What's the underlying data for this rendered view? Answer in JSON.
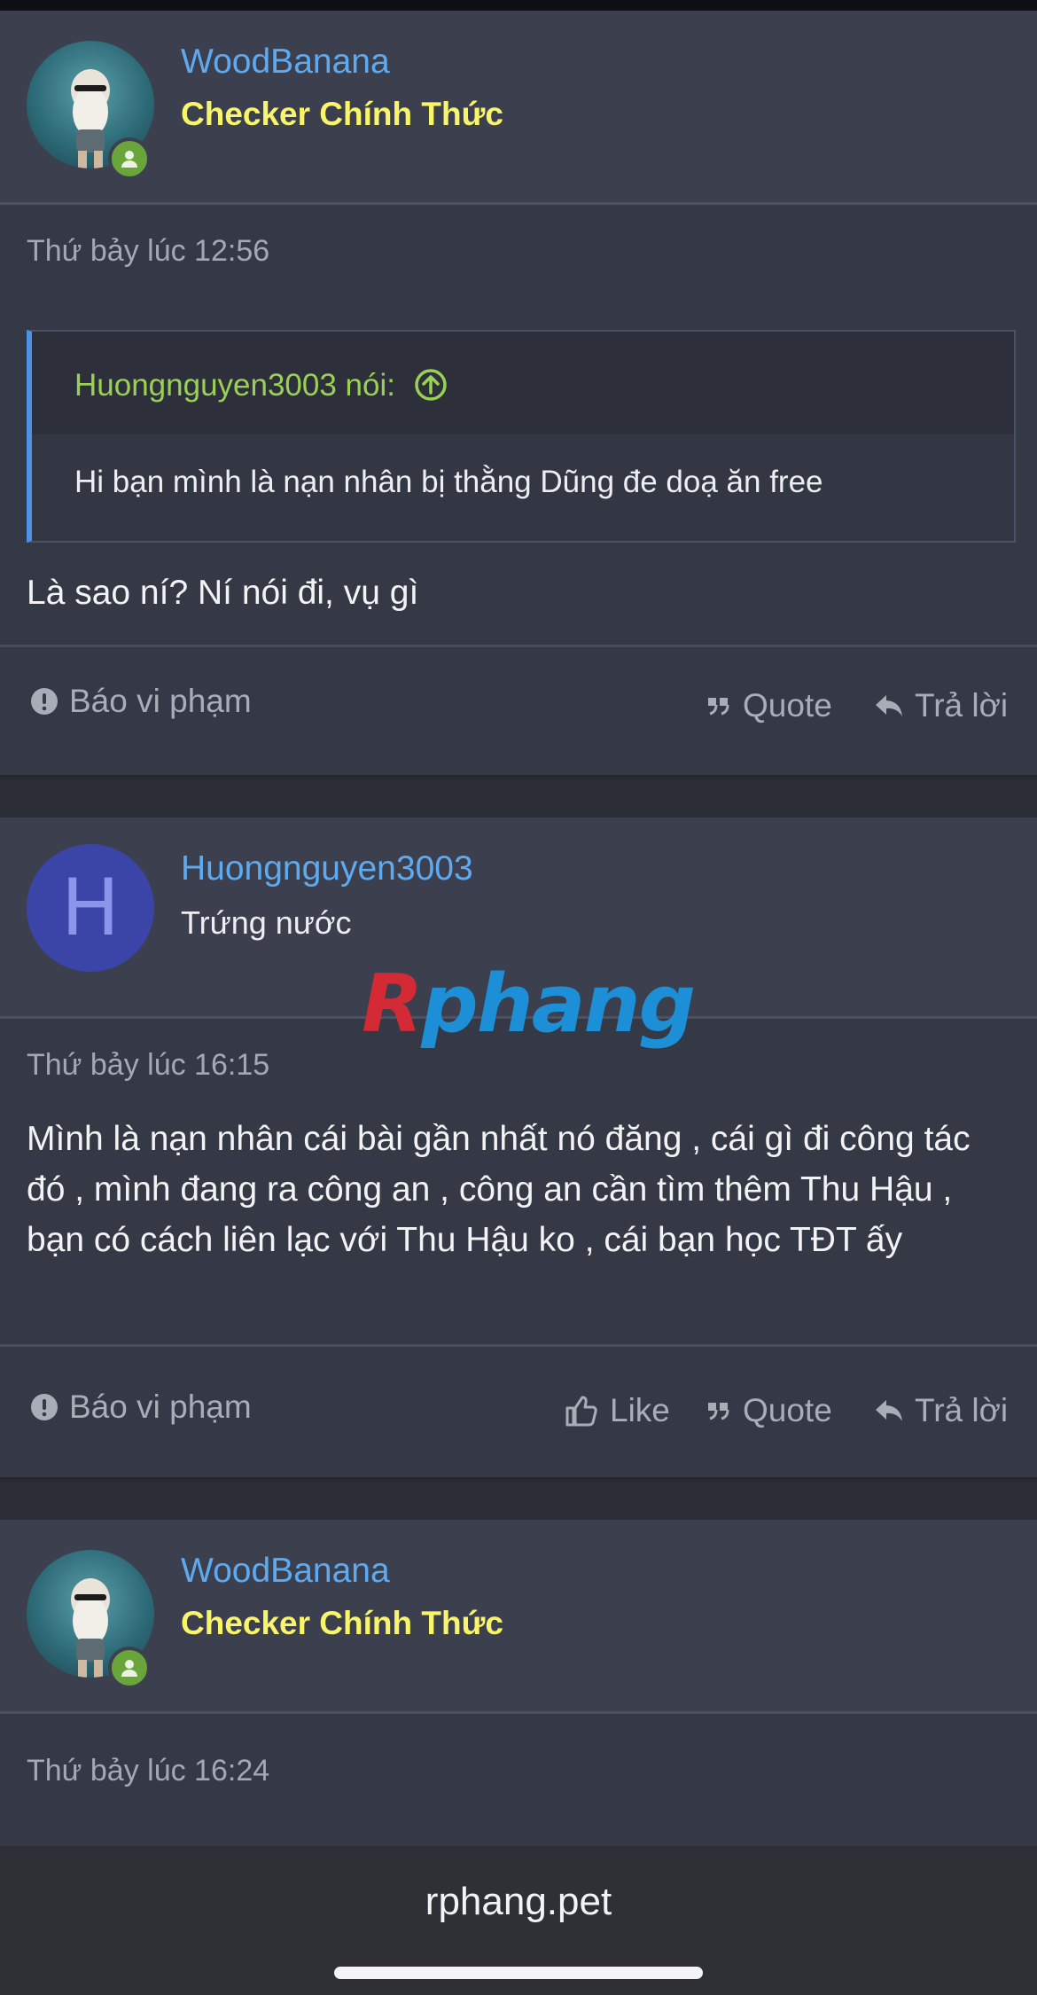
{
  "posts": [
    {
      "author": "WoodBanana",
      "user_title": "Checker Chính Thức",
      "timestamp": "Thứ bảy lúc 12:56",
      "quote_author": "Huongnguyen3003 nói:",
      "quote_text": "Hi bạn mình là nạn nhân bị thằng Dũng đe doạ ăn free",
      "message": "Là sao ní? Ní nói đi, vụ gì",
      "actions": {
        "report": "Báo vi phạm",
        "quote": "Quote",
        "reply": "Trả lời"
      }
    },
    {
      "author": "Huongnguyen3003",
      "avatar_letter": "H",
      "user_title": "Trứng nước",
      "timestamp": "Thứ bảy lúc 16:15",
      "message": "Mình là nạn nhân cái bài gần nhất nó đăng , cái gì đi công tác đó , mình đang ra công an , công an cần tìm thêm Thu Hậu , bạn có cách liên lạc với Thu Hậu ko , cái bạn học TĐT ấy",
      "actions": {
        "report": "Báo vi phạm",
        "like": "Like",
        "quote": "Quote",
        "reply": "Trả lời"
      }
    },
    {
      "author": "WoodBanana",
      "user_title": "Checker Chính Thức",
      "timestamp": "Thứ bảy lúc 16:24"
    }
  ],
  "watermark": {
    "first": "R",
    "rest": "phang"
  },
  "browser": {
    "url": "rphang.pet"
  },
  "colors": {
    "username": "#5eaaf0",
    "checker_title": "#f8f56a",
    "quote_author": "#9ad155",
    "online": "#6aa53c"
  }
}
